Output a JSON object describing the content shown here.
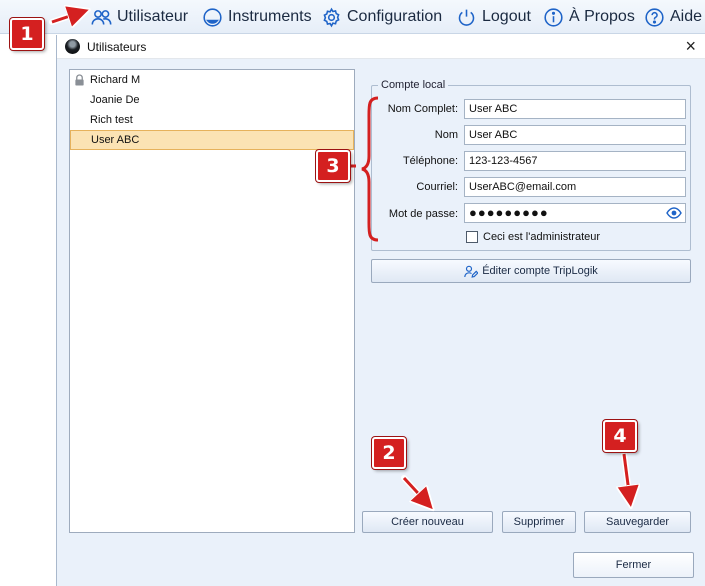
{
  "menu": {
    "items": [
      {
        "label": "Utilisateur",
        "icon": "users-icon"
      },
      {
        "label": "Instruments",
        "icon": "instrument-icon"
      },
      {
        "label": "Configuration",
        "icon": "gear-icon"
      },
      {
        "label": "Logout",
        "icon": "power-icon"
      },
      {
        "label": "À Propos",
        "icon": "info-icon"
      },
      {
        "label": "Aide",
        "icon": "help-icon"
      }
    ]
  },
  "callouts": [
    "1",
    "2",
    "3",
    "4"
  ],
  "dialog": {
    "title": "Utilisateurs",
    "close": "×"
  },
  "users": [
    {
      "name": "Richard M",
      "locked": true
    },
    {
      "name": "Joanie De",
      "locked": false
    },
    {
      "name": "Rich test",
      "locked": false
    },
    {
      "name": "User ABC",
      "locked": false,
      "selected": true
    }
  ],
  "form": {
    "group_title": "Compte local",
    "full_name_label": "Nom Complet:",
    "full_name_value": "User ABC",
    "name_label": "Nom",
    "name_value": "User ABC",
    "phone_label": "Téléphone:",
    "phone_value": "123-123-4567",
    "email_label": "Courriel:",
    "email_value": "UserABC@email.com",
    "password_label": "Mot de passe:",
    "password_value": "●●●●●●●●●",
    "admin_label": "Ceci est l'administrateur",
    "admin_checked": false
  },
  "buttons": {
    "edit_triplogik": "Éditer compte TripLogik",
    "create_new": "Créer nouveau",
    "delete": "Supprimer",
    "save": "Sauvegarder",
    "close": "Fermer"
  },
  "colors": {
    "accent": "#1f64c8",
    "callout": "#d42020",
    "selection": "#fbe3b4"
  }
}
